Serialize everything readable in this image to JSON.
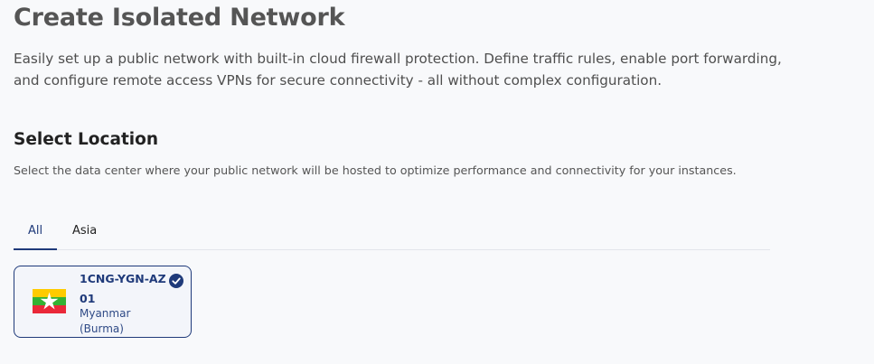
{
  "header": {
    "title": "Create Isolated Network",
    "description": "Easily set up a public network with built-in cloud firewall protection. Define traffic rules, enable port forwarding, and configure remote access VPNs for secure connectivity - all without complex configuration."
  },
  "location": {
    "title": "Select Location",
    "description": "Select the data center where your public network will be hosted to optimize performance and connectivity for your instances.",
    "tabs": [
      {
        "label": "All",
        "active": true
      },
      {
        "label": "Asia",
        "active": false
      }
    ],
    "options": [
      {
        "code": "1CNG-YGN-AZ01",
        "country": "Myanmar (Burma)",
        "flag_icon": "myanmar-flag-icon",
        "selected": true
      }
    ]
  },
  "colors": {
    "accent": "#1f3a7a",
    "flag_yellow": "#fecb00",
    "flag_green": "#34b233",
    "flag_red": "#ea2839"
  }
}
